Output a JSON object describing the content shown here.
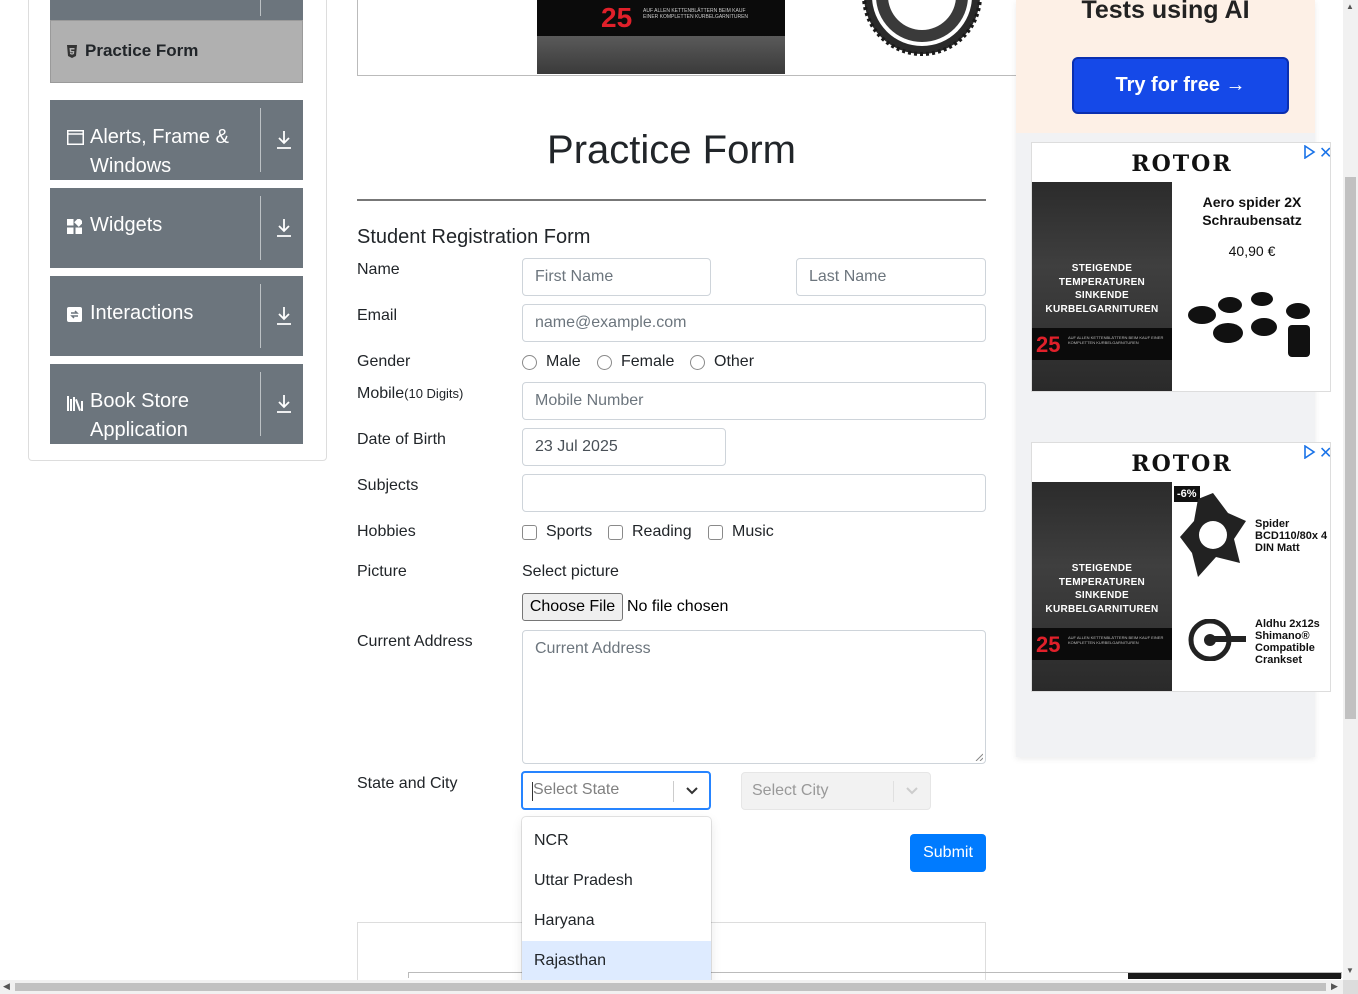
{
  "sidebar": {
    "active_item": "Practice Form",
    "groups": [
      {
        "label": "Alerts, Frame & Windows",
        "icon": "window-icon"
      },
      {
        "label": "Widgets",
        "icon": "widgets-icon"
      },
      {
        "label": "Interactions",
        "icon": "interactions-icon"
      },
      {
        "label": "Book Store Application",
        "icon": "books-icon"
      }
    ]
  },
  "top_ad": {
    "big_number": "25",
    "fine_print": "AUF ALLEN KETTENBLÄTTERN BEIM KAUF EINER KOMPLETTEN KURBELGARNITUREN"
  },
  "form": {
    "title": "Practice Form",
    "subtitle": "Student Registration Form",
    "labels": {
      "name": "Name",
      "email": "Email",
      "gender": "Gender",
      "mobile": "Mobile",
      "mobile_hint": "(10 Digits)",
      "dob": "Date of Birth",
      "subjects": "Subjects",
      "hobbies": "Hobbies",
      "picture": "Picture",
      "address": "Current Address",
      "state_city": "State and City"
    },
    "placeholders": {
      "first_name": "First Name",
      "last_name": "Last Name",
      "email": "name@example.com",
      "mobile": "Mobile Number",
      "address": "Current Address",
      "state": "Select State",
      "city": "Select City"
    },
    "dob_value": "23 Jul 2025",
    "gender_options": [
      "Male",
      "Female",
      "Other"
    ],
    "hobby_options": [
      "Sports",
      "Reading",
      "Music"
    ],
    "picture_label": "Select picture",
    "file_button": "Choose File",
    "file_status": "No file chosen",
    "state_options": [
      "NCR",
      "Uttar Pradesh",
      "Haryana",
      "Rajasthan"
    ],
    "focused_option": "Rajasthan",
    "submit": "Submit"
  },
  "ads": {
    "top": {
      "headline": "Tests using AI",
      "button": "Try for free →"
    },
    "card1": {
      "brand": "ROTOR",
      "photo_text": "STEIGENDE TEMPERATUREN SINKENDE KURBELGARNITUREN",
      "number": "25",
      "fine_print": "AUF ALLEN KETTENBLÄTTERN BEIM KAUF EINER KOMPLETTEN KURBELGARNITUREN",
      "product": "Aero spider 2X Schraubensatz",
      "price": "40,90 €"
    },
    "card2": {
      "brand": "ROTOR",
      "photo_text": "STEIGENDE TEMPERATUREN SINKENDE KURBELGARNITUREN",
      "number": "25",
      "fine_print": "AUF ALLEN KETTENBLÄTTERN BEIM KAUF EINER KOMPLETTEN KURBELGARNITUREN",
      "discount": "-6%",
      "product1": "Spider BCD110/80x 4 DIN Matt",
      "product2": "Aldhu 2x12s Shimano® Compatible Crankset"
    },
    "close": "✕"
  },
  "colors": {
    "sidebar_group": "#6c757d",
    "active_item": "#b0b0b0",
    "primary": "#007bff",
    "focus_border": "#2684ff",
    "option_focus": "#deebff"
  }
}
